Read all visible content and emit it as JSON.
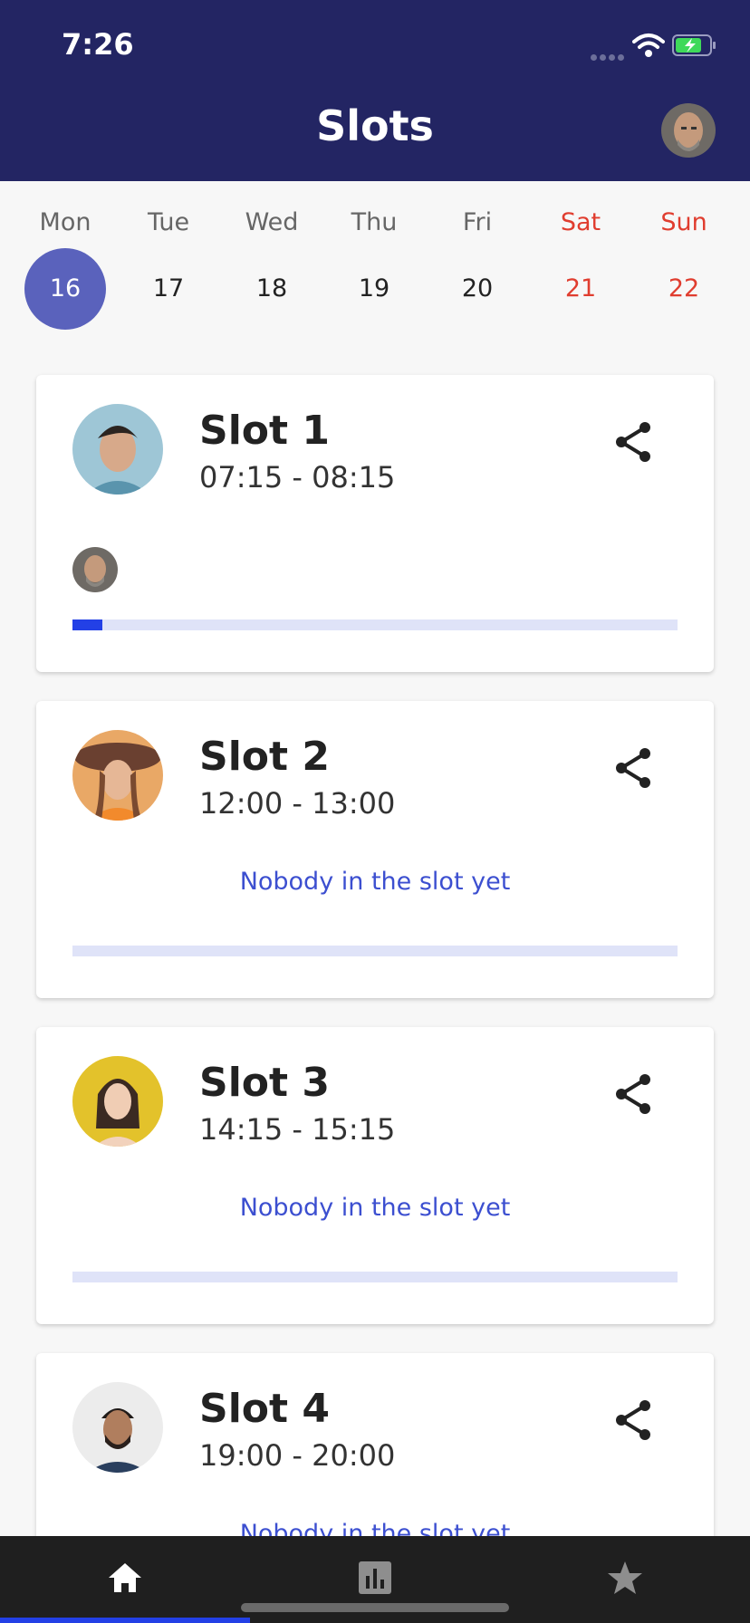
{
  "status_bar": {
    "time": "7:26"
  },
  "header": {
    "title": "Slots"
  },
  "week": [
    {
      "name": "Mon",
      "num": "16",
      "selected": true,
      "weekend": false
    },
    {
      "name": "Tue",
      "num": "17",
      "selected": false,
      "weekend": false
    },
    {
      "name": "Wed",
      "num": "18",
      "selected": false,
      "weekend": false
    },
    {
      "name": "Thu",
      "num": "19",
      "selected": false,
      "weekend": false
    },
    {
      "name": "Fri",
      "num": "20",
      "selected": false,
      "weekend": false
    },
    {
      "name": "Sat",
      "num": "21",
      "selected": false,
      "weekend": true
    },
    {
      "name": "Sun",
      "num": "22",
      "selected": false,
      "weekend": true
    }
  ],
  "slots": [
    {
      "title": "Slot 1",
      "time": "07:15 - 08:15",
      "progress": 0.05,
      "empty_text": ""
    },
    {
      "title": "Slot 2",
      "time": "12:00 - 13:00",
      "progress": 0,
      "empty_text": "Nobody in the slot yet"
    },
    {
      "title": "Slot 3",
      "time": "14:15 - 15:15",
      "progress": 0,
      "empty_text": "Nobody in the slot yet"
    },
    {
      "title": "Slot 4",
      "time": "19:00 - 20:00",
      "progress": 0,
      "empty_text": "Nobody in the slot yet"
    }
  ],
  "icons": {
    "share": "share-icon",
    "home": "home-icon",
    "stats": "bar-chart-icon",
    "favorites": "star-icon"
  },
  "colors": {
    "header_bg": "#232563",
    "selected_day": "#5a62bc",
    "weekend": "#e03d2f",
    "accent": "#2340e6",
    "empty_text": "#3c4fd0"
  },
  "bottom_nav": {
    "active": "home"
  }
}
